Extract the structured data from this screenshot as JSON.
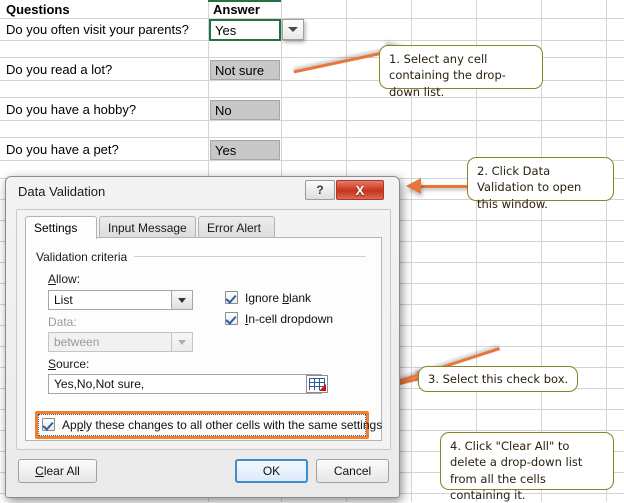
{
  "spreadsheet": {
    "columns": [
      {
        "header": "Questions"
      },
      {
        "header": "Answer"
      }
    ],
    "rows": [
      {
        "question": "Do you often visit your parents?",
        "answer": "Yes",
        "selected": true
      },
      {
        "question": "Do you read a lot?",
        "answer": "Not sure",
        "selected": false
      },
      {
        "question": "Do you have a hobby?",
        "answer": "No",
        "selected": false
      },
      {
        "question": "Do you have a pet?",
        "answer": "Yes",
        "selected": false
      }
    ],
    "dropdown_button_icon": "chevron-down-icon",
    "selection_border_color": "#217346",
    "answer_cell_fill": "#c8c8c8"
  },
  "callouts": [
    {
      "id": 1,
      "text": "1. Select any cell containing the drop-down list."
    },
    {
      "id": 2,
      "text": "2. Click Data Validation to open this window."
    },
    {
      "id": 3,
      "text": "3. Select this check box."
    },
    {
      "id": 4,
      "text": "4. Click \"Clear All\" to delete a drop-down list from all the cells containing it."
    }
  ],
  "callout_style": {
    "border": "#8a8325",
    "arrow": "#e8763a"
  },
  "dialog": {
    "title": "Data Validation",
    "help_label": "?",
    "close_label": "X",
    "tabs": [
      {
        "label": "Settings",
        "active": true
      },
      {
        "label": "Input Message",
        "active": false
      },
      {
        "label": "Error Alert",
        "active": false
      }
    ],
    "group_label": "Validation criteria",
    "allow": {
      "label": "Allow:",
      "label_accel": "A",
      "value": "List",
      "icon": "chevron-down-icon"
    },
    "data": {
      "label": "Data:",
      "value": "between",
      "disabled": true,
      "icon": "chevron-down-icon"
    },
    "source": {
      "label": "Source:",
      "label_accel": "S",
      "value": "Yes,No,Not sure,",
      "range_picker_icon": "range-select-icon"
    },
    "checkboxes": [
      {
        "label": "Ignore blank",
        "accel": "b",
        "checked": true
      },
      {
        "label": "In-cell dropdown",
        "accel": "I",
        "checked": true
      }
    ],
    "apply_all": {
      "label": "Apply these changes to all other cells with the same settings",
      "accel": "p",
      "checked": true,
      "highlighted": true,
      "highlight_color": "#ef8030"
    },
    "buttons": [
      {
        "label": "Clear All",
        "accel": "C",
        "name": "clear-all-button",
        "focused": false
      },
      {
        "label": "OK",
        "name": "ok-button",
        "focused": true
      },
      {
        "label": "Cancel",
        "name": "cancel-button",
        "focused": false
      }
    ]
  }
}
